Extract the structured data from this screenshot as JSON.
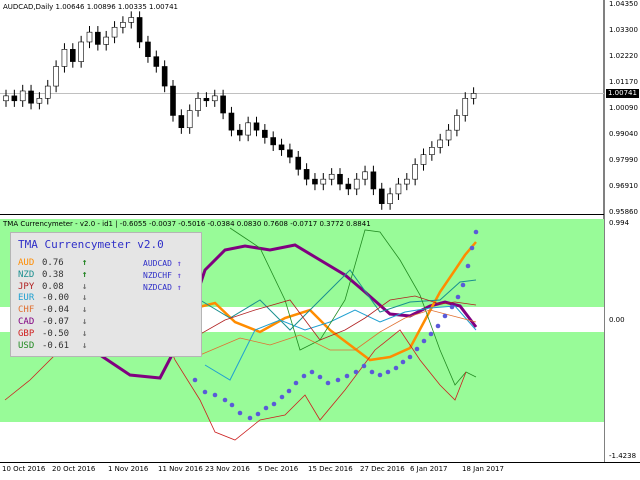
{
  "top_chart": {
    "header": "AUDCAD,Daily  1.00646 1.00896 1.00335 1.00741",
    "price_axis": [
      "1.04350",
      "1.03300",
      "1.02220",
      "1.01170",
      "1.00090",
      "0.99040",
      "0.97990",
      "0.96910",
      "0.95860"
    ],
    "current_price": "1.00741"
  },
  "indicator": {
    "header": "TMA Currencymeter - v2.0 - id1 |  -0.6055 -0.0037 -0.5016 -0.0384 0.0830 0.7608 -0.0717 0.3772 0.8841",
    "axis": {
      "top": "0.994",
      "zero": "0.00",
      "bottom": "-1.4238"
    }
  },
  "panel": {
    "title": "TMA Currencymeter v2.0",
    "rows": [
      {
        "currency": "AUD",
        "value": "0.76",
        "arrow": "↑",
        "color": "#ff8c00",
        "arrow_color": "#1a7f1a"
      },
      {
        "currency": "NZD",
        "value": "0.38",
        "arrow": "↑",
        "color": "#1a8f8f",
        "arrow_color": "#1a7f1a"
      },
      {
        "currency": "JPY",
        "value": "0.08",
        "arrow": "↓",
        "color": "#b02020",
        "arrow_color": "#707070"
      },
      {
        "currency": "EUR",
        "value": "-0.00",
        "arrow": "↓",
        "color": "#20a0d0",
        "arrow_color": "#707070"
      },
      {
        "currency": "CHF",
        "value": "-0.04",
        "arrow": "↓",
        "color": "#e07030",
        "arrow_color": "#707070"
      },
      {
        "currency": "CAD",
        "value": "-0.07",
        "arrow": "↓",
        "color": "#800080",
        "arrow_color": "#707070"
      },
      {
        "currency": "GBP",
        "value": "-0.50",
        "arrow": "↓",
        "color": "#d02020",
        "arrow_color": "#707070"
      },
      {
        "currency": "USD",
        "value": "-0.61",
        "arrow": "↓",
        "color": "#228b22",
        "arrow_color": "#707070"
      }
    ],
    "pairs": [
      {
        "name": "AUDCAD",
        "arrow": "↑"
      },
      {
        "name": "NZDCHF",
        "arrow": "↑"
      },
      {
        "name": "NZDCAD",
        "arrow": "↑"
      }
    ]
  },
  "dates": [
    "10 Oct 2016",
    "20 Oct 2016",
    "1 Nov 2016",
    "11 Nov 2016",
    "23 Nov 2016",
    "5 Dec 2016",
    "15 Dec 2016",
    "27 Dec 2016",
    "6 Jan 2017",
    "18 Jan 2017"
  ],
  "chart_data": {
    "type": "candlestick",
    "title": "AUDCAD,Daily",
    "ohlc_last": {
      "open": 1.00646,
      "high": 1.00896,
      "low": 1.00335,
      "close": 1.00741
    },
    "ylim": [
      0.9586,
      1.0435
    ],
    "approx_close_series": [
      1.006,
      1.004,
      1.008,
      1.003,
      1.005,
      1.01,
      1.018,
      1.025,
      1.02,
      1.028,
      1.032,
      1.027,
      1.03,
      1.034,
      1.036,
      1.038,
      1.028,
      1.022,
      1.018,
      1.01,
      0.998,
      0.993,
      1.0,
      1.005,
      1.004,
      1.006,
      0.999,
      0.992,
      0.99,
      0.995,
      0.992,
      0.989,
      0.986,
      0.984,
      0.981,
      0.976,
      0.972,
      0.97,
      0.972,
      0.974,
      0.97,
      0.968,
      0.972,
      0.975,
      0.968,
      0.962,
      0.966,
      0.97,
      0.972,
      0.978,
      0.982,
      0.985,
      0.988,
      0.992,
      0.998,
      1.005,
      1.007
    ],
    "indicator_ylim": [
      -1.4238,
      0.994
    ],
    "indicator_values": {
      "AUD": 0.76,
      "NZD": 0.38,
      "JPY": 0.08,
      "EUR": -0.0,
      "CHF": -0.04,
      "CAD": -0.07,
      "GBP": -0.5,
      "USD": -0.61
    }
  }
}
